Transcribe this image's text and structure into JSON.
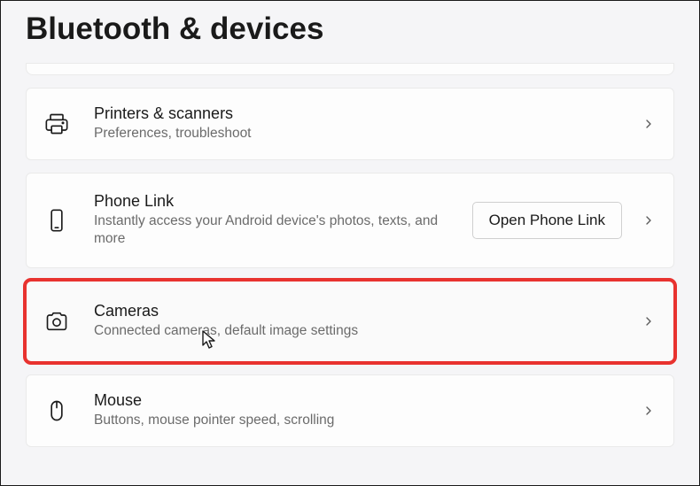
{
  "page": {
    "title": "Bluetooth & devices"
  },
  "items": [
    {
      "key": "printers",
      "title": "Printers & scanners",
      "subtitle": "Preferences, troubleshoot"
    },
    {
      "key": "phonelink",
      "title": "Phone Link",
      "subtitle": "Instantly access your Android device's photos, texts, and more",
      "action_label": "Open Phone Link"
    },
    {
      "key": "cameras",
      "title": "Cameras",
      "subtitle": "Connected cameras, default image settings"
    },
    {
      "key": "mouse",
      "title": "Mouse",
      "subtitle": "Buttons, mouse pointer speed, scrolling"
    }
  ],
  "highlight": {
    "index": 2,
    "color": "#e8322f"
  }
}
